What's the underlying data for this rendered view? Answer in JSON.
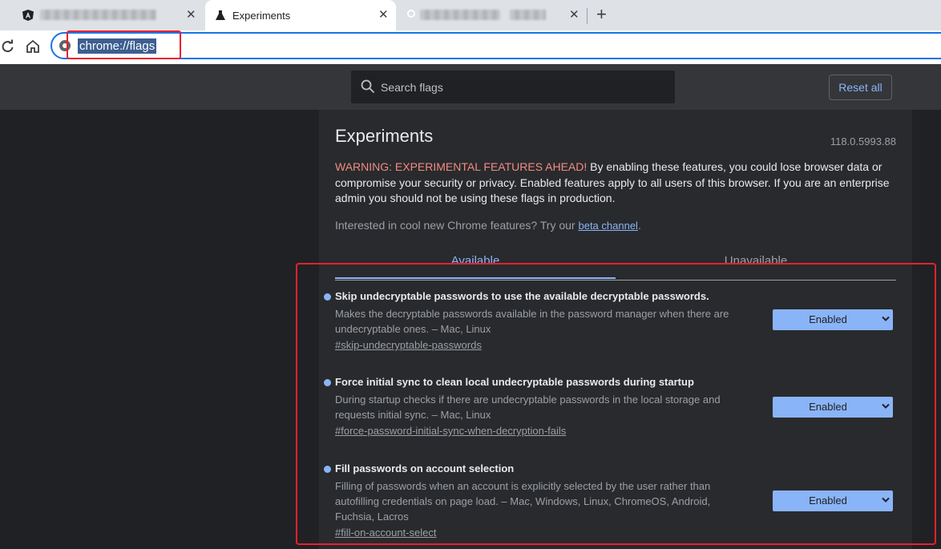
{
  "tabs": [
    {
      "title": "",
      "blurred": true
    },
    {
      "title": "Experiments",
      "active": true
    },
    {
      "title": "",
      "blurred": true
    }
  ],
  "address_bar": {
    "url": "chrome://flags"
  },
  "search": {
    "placeholder": "Search flags"
  },
  "reset_label": "Reset all",
  "page": {
    "title": "Experiments",
    "version": "118.0.5993.88",
    "warning_label": "WARNING: EXPERIMENTAL FEATURES AHEAD!",
    "warning_text": " By enabling these features, you could lose browser data or compromise your security or privacy. Enabled features apply to all users of this browser. If you are an enterprise admin you should not be using these flags in production.",
    "interest_text": "Interested in cool new Chrome features? Try our ",
    "interest_link": "beta channel",
    "interest_end": "."
  },
  "view_tabs": {
    "available": "Available",
    "unavailable": "Unavailable"
  },
  "experiments": [
    {
      "name": "Skip undecryptable passwords to use the available decryptable passwords.",
      "description": "Makes the decryptable passwords available in the password manager when there are undecryptable ones. – Mac, Linux",
      "permalink": "#skip-undecryptable-passwords",
      "value": "Enabled"
    },
    {
      "name": "Force initial sync to clean local undecryptable passwords during startup",
      "description": "During startup checks if there are undecryptable passwords in the local storage and requests initial sync. – Mac, Linux",
      "permalink": "#force-password-initial-sync-when-decryption-fails",
      "value": "Enabled"
    },
    {
      "name": "Fill passwords on account selection",
      "description": "Filling of passwords when an account is explicitly selected by the user rather than autofilling credentials on page load. – Mac, Windows, Linux, ChromeOS, Android, Fuchsia, Lacros",
      "permalink": "#fill-on-account-select",
      "value": "Enabled"
    }
  ],
  "colors": {
    "accent": "#8ab4f8",
    "warning": "#f28b82",
    "annotation": "#e8202f"
  }
}
